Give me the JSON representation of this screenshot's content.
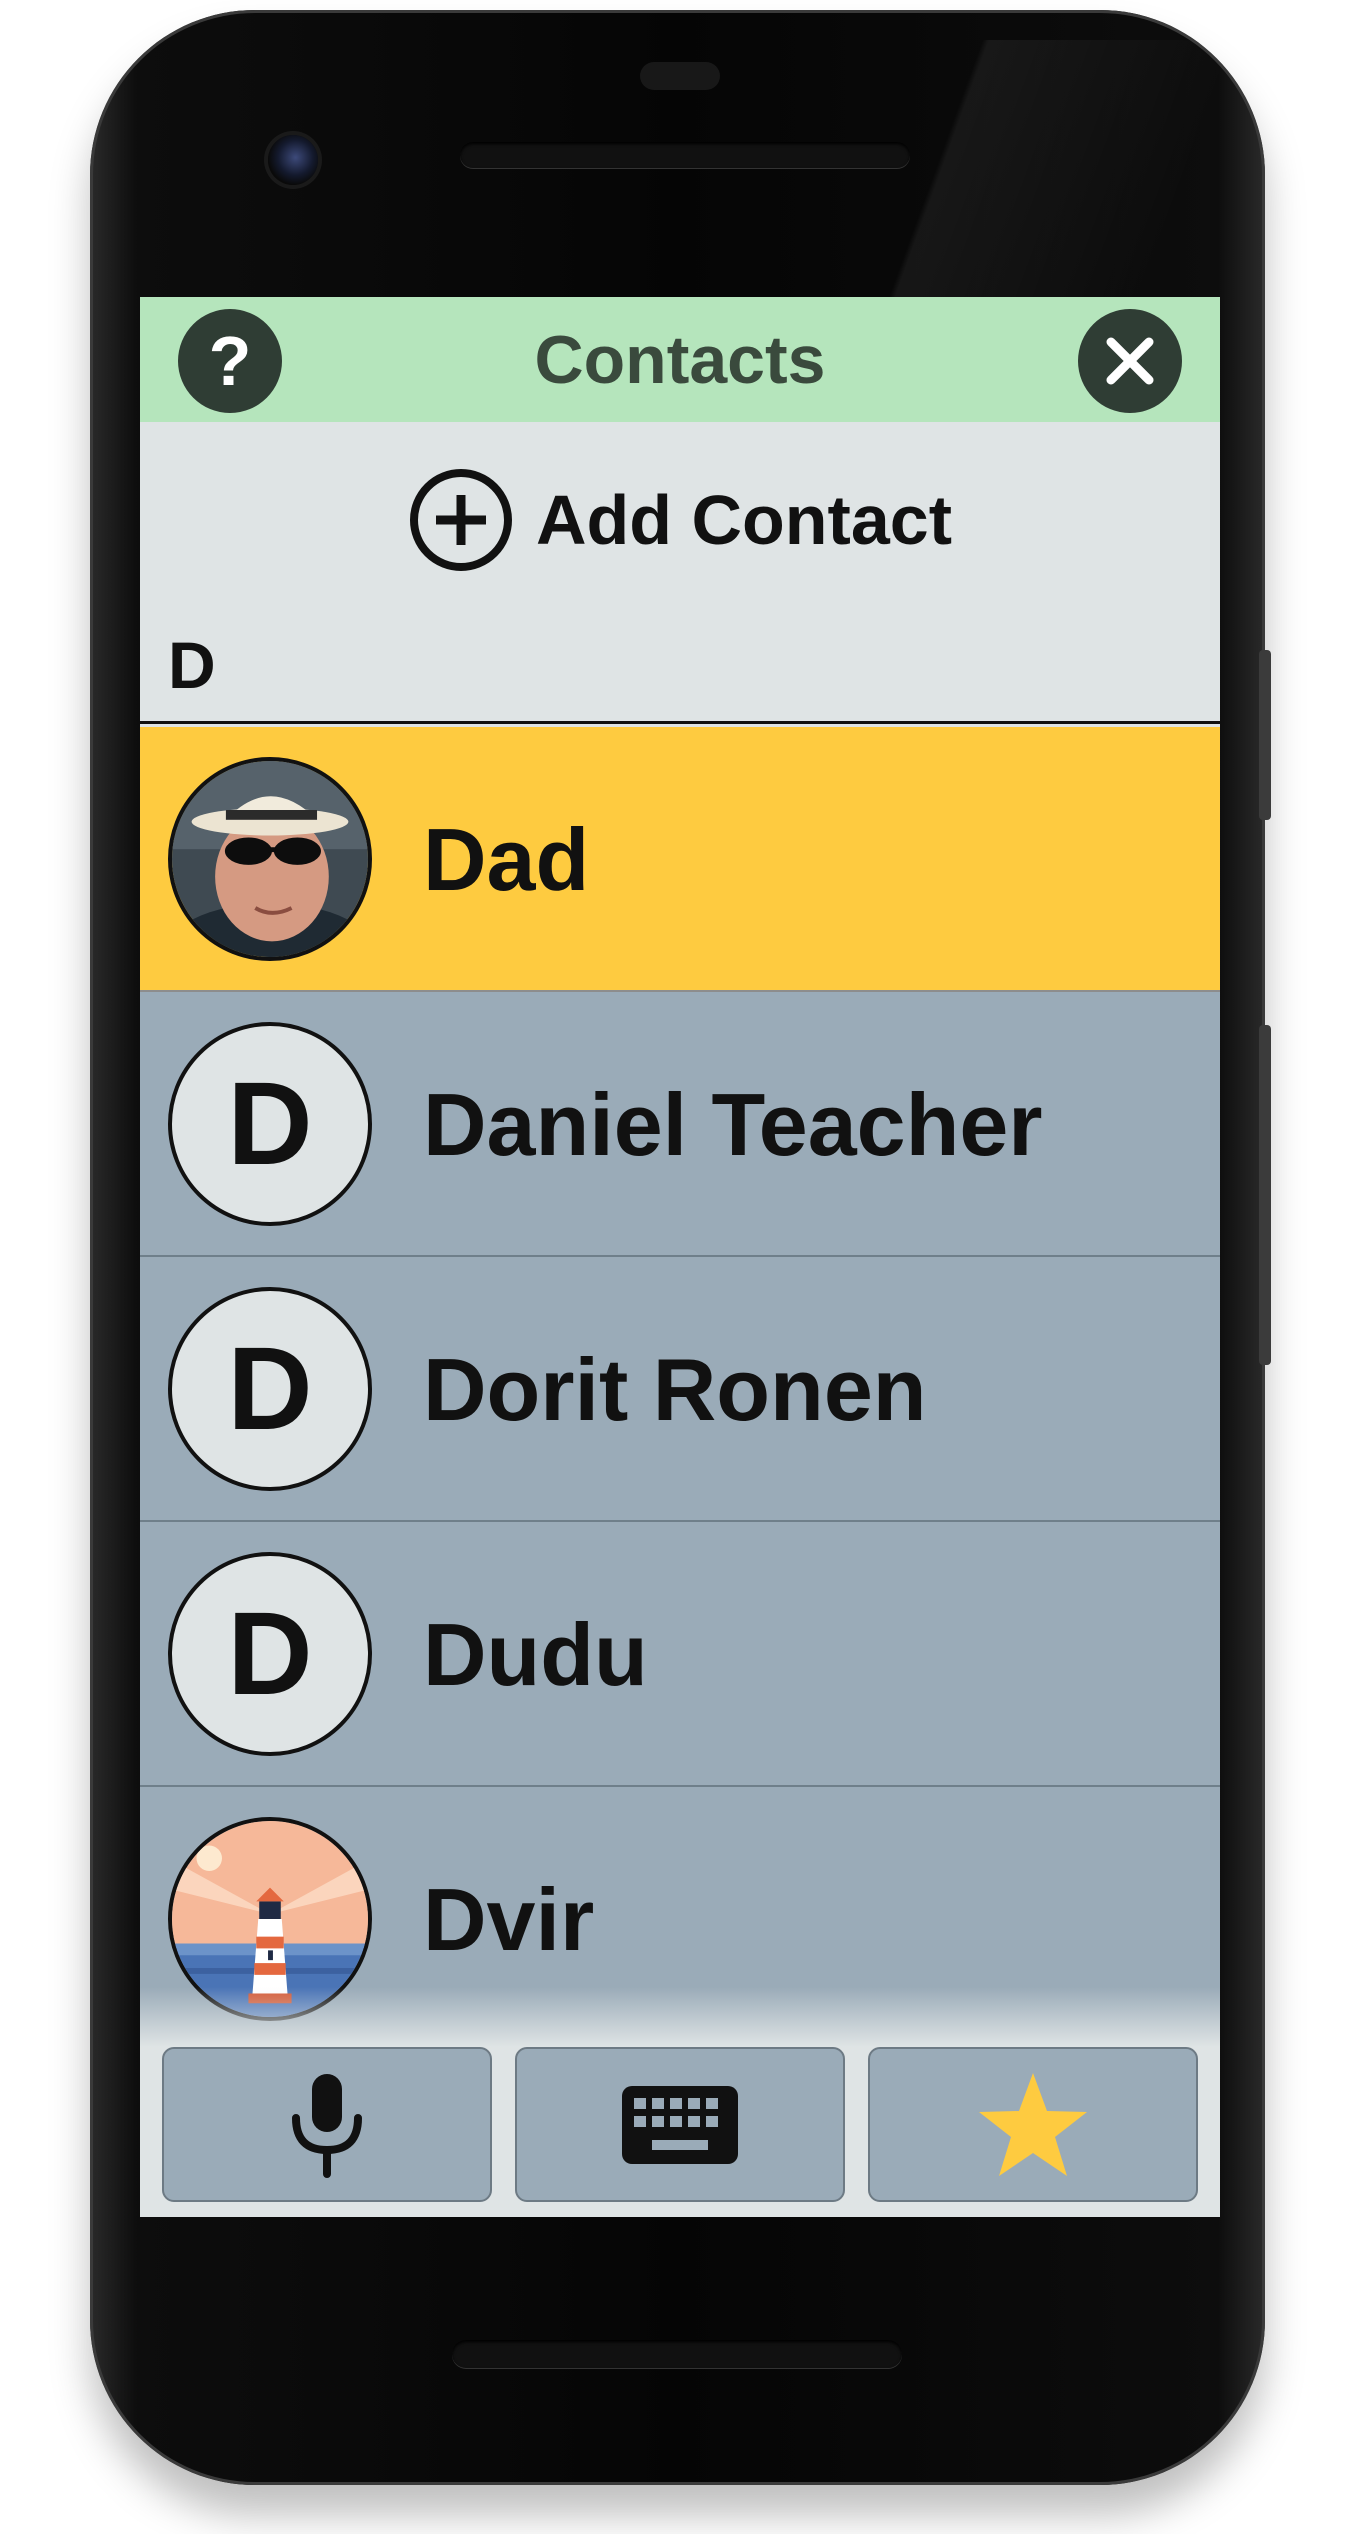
{
  "header": {
    "title": "Contacts",
    "help_icon": "question-mark-icon",
    "help_glyph": "?",
    "close_icon": "close-x-icon"
  },
  "add_contact": {
    "label": "Add Contact",
    "icon": "add-circle-icon"
  },
  "section": {
    "letter": "D"
  },
  "contacts": [
    {
      "name": "Dad",
      "avatar": "photo",
      "selected": true
    },
    {
      "name": "Daniel Teacher",
      "avatar": "letter",
      "initial": "D",
      "selected": false
    },
    {
      "name": "Dorit Ronen",
      "avatar": "letter",
      "initial": "D",
      "selected": false
    },
    {
      "name": "Dudu",
      "avatar": "letter",
      "initial": "D",
      "selected": false
    },
    {
      "name": "Dvir",
      "avatar": "lighthouse-image",
      "selected": false
    }
  ],
  "toolbar": {
    "buttons": [
      {
        "icon": "microphone-icon"
      },
      {
        "icon": "keyboard-icon"
      },
      {
        "icon": "star-icon"
      }
    ]
  },
  "colors": {
    "header_bg": "#b5e5bc",
    "selected_row": "#fecb40",
    "row_bg": "#9aabb8",
    "screen_bg": "#dfe4e5",
    "star": "#fecb40"
  }
}
